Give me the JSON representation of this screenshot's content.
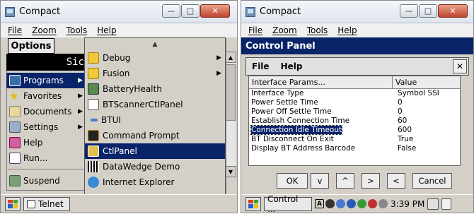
{
  "left": {
    "title": "Compact",
    "menu": [
      "File",
      "Zoom",
      "Tools",
      "Help"
    ],
    "options_label": "Options",
    "banner_text": "Sic",
    "start_items": [
      {
        "label": "Programs",
        "has_arrow": true,
        "icon": "programs-icon"
      },
      {
        "label": "Favorites",
        "has_arrow": true,
        "icon": "favorites-icon"
      },
      {
        "label": "Documents",
        "has_arrow": true,
        "icon": "documents-icon"
      },
      {
        "label": "Settings",
        "has_arrow": true,
        "icon": "settings-icon"
      },
      {
        "label": "Help",
        "has_arrow": false,
        "icon": "help-icon"
      },
      {
        "label": "Run...",
        "has_arrow": false,
        "icon": "run-icon"
      },
      {
        "label": "Suspend",
        "has_arrow": false,
        "icon": "suspend-icon"
      }
    ],
    "programs": [
      {
        "label": "Debug",
        "icon": "folder-icon",
        "arrow": true
      },
      {
        "label": "Fusion",
        "icon": "folder-icon",
        "arrow": true
      },
      {
        "label": "BatteryHealth",
        "icon": "battery-icon"
      },
      {
        "label": "BTScannerCtlPanel",
        "icon": "bt-scanner-icon"
      },
      {
        "label": "BTUI",
        "icon": "btui-icon"
      },
      {
        "label": "Command Prompt",
        "icon": "command-prompt-icon"
      },
      {
        "label": "CtlPanel",
        "icon": "ctlpanel-icon",
        "selected": true
      },
      {
        "label": "DataWedge Demo",
        "icon": "datawedge-icon"
      },
      {
        "label": "Internet Explorer",
        "icon": "ie-icon"
      }
    ],
    "taskbar": {
      "task": "Telnet"
    }
  },
  "right": {
    "title": "Compact",
    "menu": [
      "File",
      "Zoom",
      "Tools",
      "Help"
    ],
    "header": "Control Panel",
    "toolbar_menu": [
      "File",
      "Help"
    ],
    "columns": [
      "Interface Params...",
      "Value"
    ],
    "rows": [
      [
        "Interface Type",
        "Symbol SSI"
      ],
      [
        "Power Settle Time",
        "0"
      ],
      [
        "Power Off Settle Time",
        "0"
      ],
      [
        "Establish Connection Time",
        "60"
      ],
      [
        "Connection Idle Timeout",
        "600"
      ],
      [
        "BT Disconnect On Exit",
        "True"
      ],
      [
        "Display BT Address Barcode",
        "False"
      ]
    ],
    "selected_row": 4,
    "buttons": [
      "OK",
      "v",
      "^",
      ">",
      "<",
      "Cancel"
    ],
    "taskbar": {
      "task": "Control ...",
      "time": "3:39 PM"
    }
  }
}
